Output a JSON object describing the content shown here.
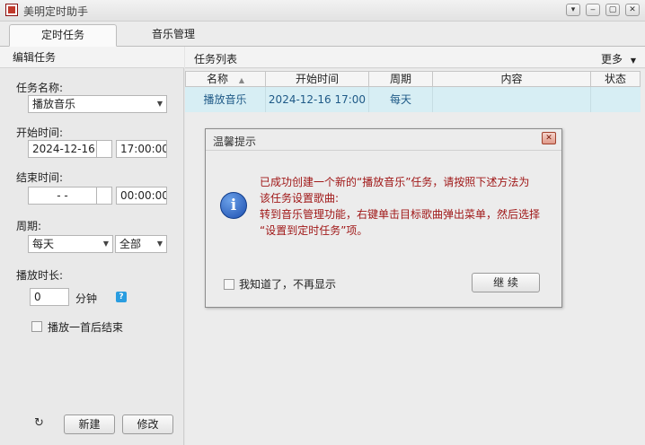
{
  "window": {
    "title": "美明定时助手",
    "controls": [
      "▾",
      "‒",
      "▢",
      "✕"
    ]
  },
  "tabs": [
    {
      "label": "定时任务",
      "active": true
    },
    {
      "label": "音乐管理",
      "active": false
    }
  ],
  "edit_panel": {
    "header": "编辑任务",
    "task_name_label": "任务名称:",
    "task_name_value": "播放音乐",
    "start_label": "开始时间:",
    "start_date": "2024-12-16",
    "start_time": "17:00:00",
    "end_label": "结束时间:",
    "end_date": "-   -",
    "end_time": "00:00:00",
    "period_label": "周期:",
    "period_value": "每天",
    "period_scope": "全部",
    "duration_label": "播放时长:",
    "duration_value": "0",
    "duration_unit": "分钟",
    "help_glyph": "?",
    "stop_after_one_label": "播放一首后结束",
    "refresh_glyph": "↻",
    "new_button": "新建",
    "edit_button": "修改"
  },
  "task_list": {
    "header": "任务列表",
    "more_label": "更多",
    "columns": [
      "名称",
      "开始时间",
      "周期",
      "内容",
      "状态"
    ],
    "sort_glyph": "▲",
    "rows": [
      {
        "name": "播放音乐",
        "start": "2024-12-16 17:00",
        "period": "每天",
        "content": "",
        "status": ""
      }
    ]
  },
  "dialog": {
    "title": "温馨提示",
    "close_glyph": "✕",
    "icon_glyph": "i",
    "message_lines": [
      "已成功创建一个新的“播放音乐”任务，请按照下述方法为",
      "该任务设置歌曲:",
      "转到音乐管理功能，右键单击目标歌曲弹出菜单，然后选择",
      "“设置到定时任务”项。"
    ],
    "dont_show_label": "我知道了，不再显示",
    "continue_button": "继 续"
  },
  "colors": {
    "selected_row_bg": "#d7eef4",
    "message_text": "#a01818",
    "info_icon": "#1d4fb0"
  }
}
